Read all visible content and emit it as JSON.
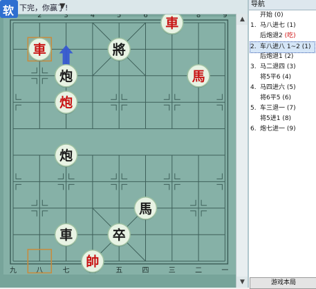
{
  "status": {
    "text": "下完，你赢了!"
  },
  "logo": {
    "text": "软"
  },
  "board": {
    "top_labels": [
      "1",
      "2",
      "3",
      "4",
      "5",
      "6",
      "7",
      "8",
      "9"
    ],
    "bottom_labels": [
      "九",
      "八",
      "七",
      "六",
      "五",
      "四",
      "三",
      "二",
      "一"
    ],
    "pieces": [
      {
        "char": "車",
        "side": "red",
        "file": 6,
        "rank": 0,
        "name": "piece-red-chariot-1"
      },
      {
        "char": "車",
        "side": "red",
        "file": 1,
        "rank": 1,
        "name": "piece-red-chariot-2"
      },
      {
        "char": "將",
        "side": "black",
        "file": 4,
        "rank": 1,
        "name": "piece-black-general"
      },
      {
        "char": "炮",
        "side": "black",
        "file": 2,
        "rank": 2,
        "name": "piece-black-cannon-1"
      },
      {
        "char": "馬",
        "side": "red",
        "file": 7,
        "rank": 2,
        "name": "piece-red-horse"
      },
      {
        "char": "炮",
        "side": "red",
        "file": 2,
        "rank": 3,
        "name": "piece-red-cannon"
      },
      {
        "char": "炮",
        "side": "black",
        "file": 2,
        "rank": 5,
        "name": "piece-black-cannon-2"
      },
      {
        "char": "馬",
        "side": "black",
        "file": 5,
        "rank": 7,
        "name": "piece-black-horse"
      },
      {
        "char": "車",
        "side": "black",
        "file": 2,
        "rank": 8,
        "name": "piece-black-chariot"
      },
      {
        "char": "卒",
        "side": "black",
        "file": 4,
        "rank": 8,
        "name": "piece-black-soldier"
      },
      {
        "char": "帥",
        "side": "red",
        "file": 3,
        "rank": 9,
        "name": "piece-red-marshal"
      }
    ]
  },
  "nav": {
    "title": "导航",
    "moves": [
      {
        "num": "",
        "text": "开始",
        "extra": "(0)",
        "note": "",
        "selected": false
      },
      {
        "num": "1.",
        "text": "马八进七",
        "extra": "(1)",
        "note": "",
        "selected": false
      },
      {
        "num": "",
        "text": "后炮退2",
        "extra": "",
        "note": "(吃)",
        "selected": false
      },
      {
        "num": "2.",
        "text": "车八进八",
        "extra": "1~2 (1)",
        "note": "",
        "selected": true
      },
      {
        "num": "",
        "text": "后炮退1",
        "extra": "(2)",
        "note": "",
        "selected": false
      },
      {
        "num": "3.",
        "text": "马二退四",
        "extra": "(3)",
        "note": "",
        "selected": false
      },
      {
        "num": "",
        "text": "将5平6",
        "extra": "(4)",
        "note": "",
        "selected": false
      },
      {
        "num": "4.",
        "text": "马四进六",
        "extra": "(5)",
        "note": "",
        "selected": false
      },
      {
        "num": "",
        "text": "将6平5",
        "extra": "(6)",
        "note": "",
        "selected": false
      },
      {
        "num": "5.",
        "text": "车三退一",
        "extra": "(7)",
        "note": "",
        "selected": false
      },
      {
        "num": "",
        "text": "将5进1",
        "extra": "(8)",
        "note": "",
        "selected": false
      },
      {
        "num": "6.",
        "text": "炮七进一",
        "extra": "(9)",
        "note": "",
        "selected": false
      }
    ],
    "button_label": "游戏本局"
  },
  "colors": {
    "board": "#77a49a",
    "grid": "#3d5f59",
    "red_piece_text": "#c81414",
    "black_piece_text": "#1a1a1a",
    "piece_face": "#e8f3e4",
    "highlight": "#c98a3a",
    "arrow": "#3457d4"
  },
  "icons": {
    "arrow": "arrow-up-icon",
    "dropdown": "dropdown-arrow-icon"
  }
}
